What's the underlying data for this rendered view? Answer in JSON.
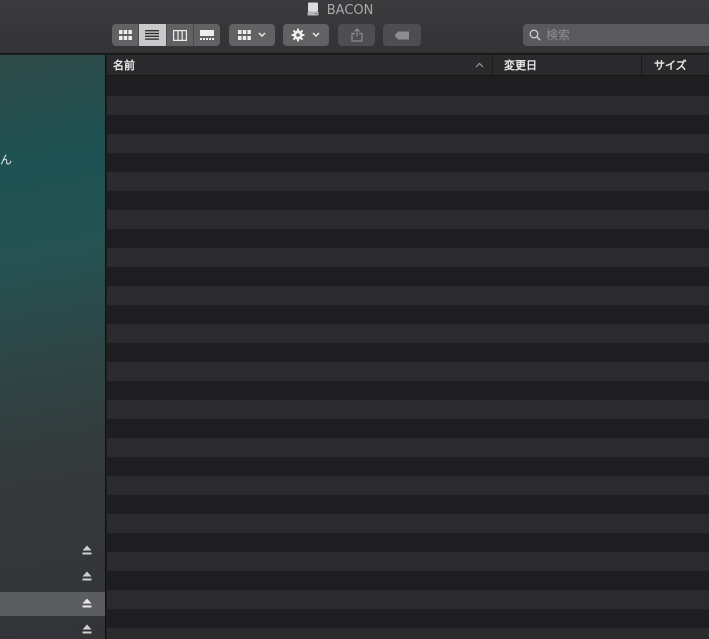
{
  "window": {
    "title": "BACON"
  },
  "toolbar": {
    "view_modes": [
      "icon-view",
      "list-view",
      "column-view",
      "gallery-view"
    ],
    "active_view": "list-view",
    "search_placeholder": "検索",
    "search_value": ""
  },
  "sidebar": {
    "truncated_label": "ん",
    "eject_items": 4,
    "selected_index": 2
  },
  "file_list": {
    "columns": [
      {
        "label": "名前",
        "sorted": "ascending"
      },
      {
        "label": "変更日"
      },
      {
        "label": "サイズ"
      }
    ],
    "items": []
  },
  "colors": {
    "window_bg": "#1e1e20",
    "row_alt": "#2b2b2e",
    "toolbar": "#38383a",
    "sidebar_accent": "#1f5253"
  }
}
